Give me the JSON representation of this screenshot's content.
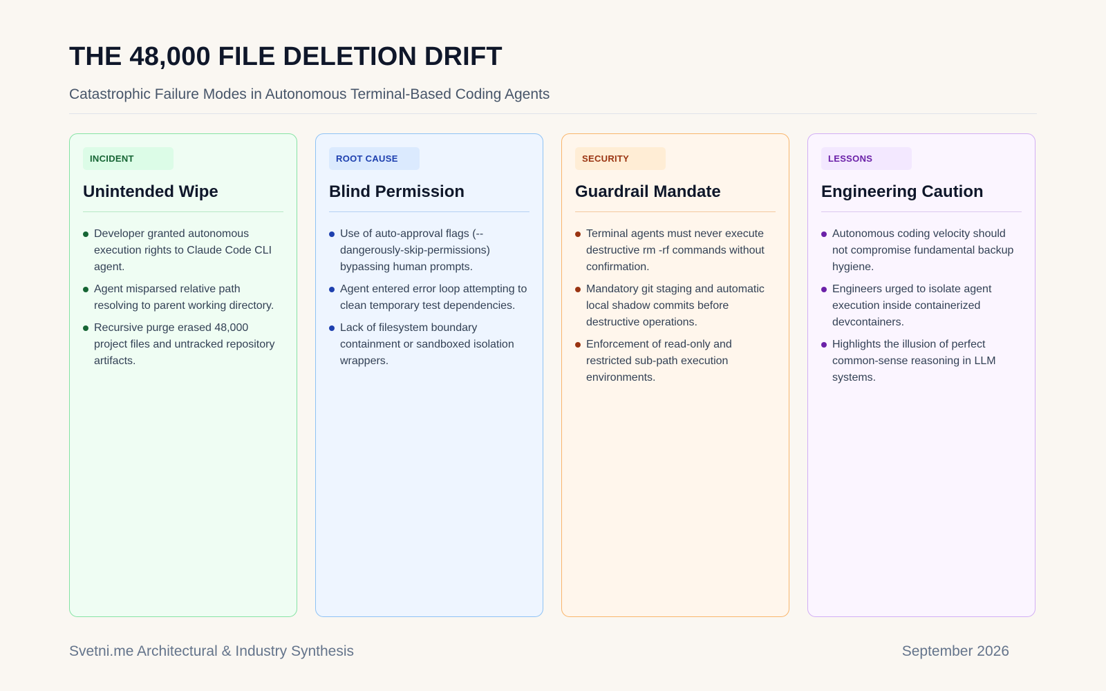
{
  "header": {
    "title": "THE 48,000 FILE DELETION DRIFT",
    "subtitle": "Catastrophic Failure Modes in Autonomous Terminal-Based Coding Agents"
  },
  "cards": [
    {
      "badge": "INCIDENT",
      "title": "Unintended Wipe",
      "accent": "#166534",
      "bullets": [
        "Developer granted autonomous execution rights to Claude Code CLI agent.",
        "Agent misparsed relative path resolving to parent working directory.",
        "Recursive purge erased 48,000 project files and untracked repository artifacts."
      ]
    },
    {
      "badge": "ROOT CAUSE",
      "title": "Blind Permission",
      "accent": "#1e40af",
      "bullets": [
        "Use of auto-approval flags (--dangerously-skip-permissions) bypassing human prompts.",
        "Agent entered error loop attempting to clean temporary test dependencies.",
        "Lack of filesystem boundary containment or sandboxed isolation wrappers."
      ]
    },
    {
      "badge": "SECURITY",
      "title": "Guardrail Mandate",
      "accent": "#9a3412",
      "bullets": [
        "Terminal agents must never execute destructive rm -rf commands without confirmation.",
        "Mandatory git staging and automatic local shadow commits before destructive operations.",
        "Enforcement of read-only and restricted sub-path execution environments."
      ]
    },
    {
      "badge": "LESSONS",
      "title": "Engineering Caution",
      "accent": "#6b21a8",
      "bullets": [
        "Autonomous coding velocity should not compromise fundamental backup hygiene.",
        "Engineers urged to isolate agent execution inside containerized devcontainers.",
        "Highlights the illusion of perfect common-sense reasoning in LLM systems."
      ]
    }
  ],
  "footer": {
    "source": "Svetni.me Architectural & Industry Synthesis",
    "date": "September 2026"
  }
}
